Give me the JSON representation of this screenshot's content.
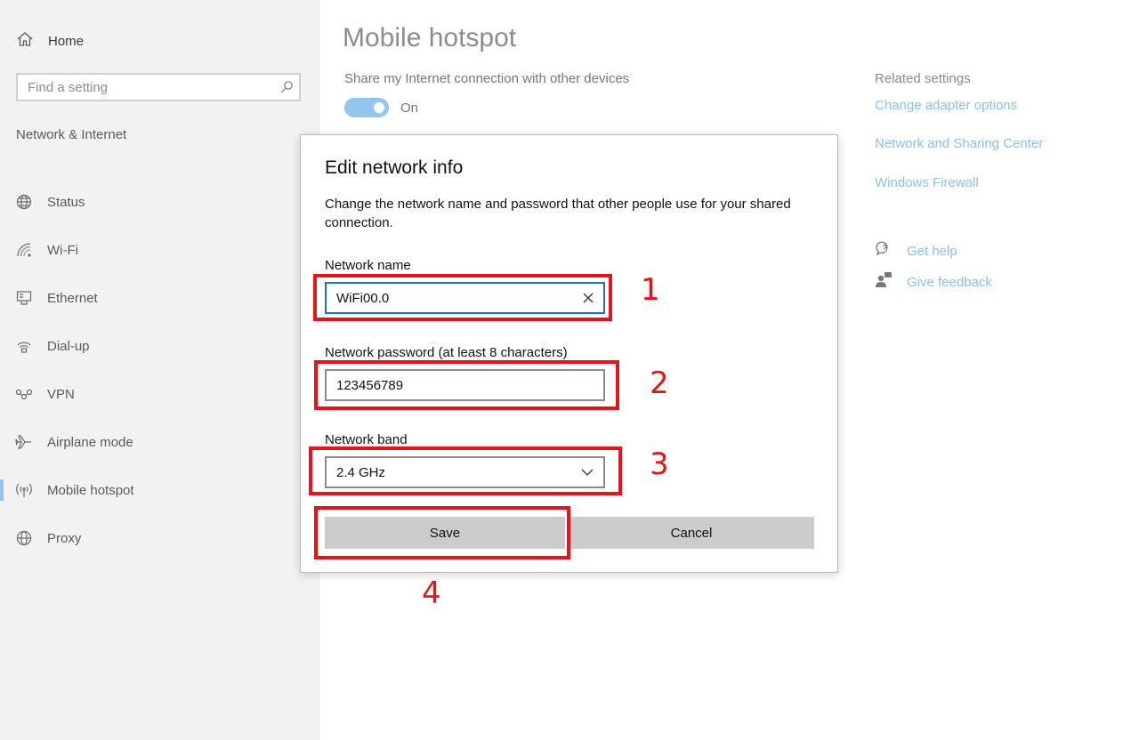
{
  "sidebar": {
    "home_label": "Home",
    "search_placeholder": "Find a setting",
    "section_title": "Network & Internet",
    "items": [
      {
        "label": "Status",
        "icon": "globe-status-icon"
      },
      {
        "label": "Wi-Fi",
        "icon": "wifi-icon"
      },
      {
        "label": "Ethernet",
        "icon": "ethernet-icon"
      },
      {
        "label": "Dial-up",
        "icon": "dial-up-icon"
      },
      {
        "label": "VPN",
        "icon": "vpn-icon"
      },
      {
        "label": "Airplane mode",
        "icon": "airplane-icon"
      },
      {
        "label": "Mobile hotspot",
        "icon": "hotspot-icon",
        "active": true
      },
      {
        "label": "Proxy",
        "icon": "globe-icon"
      }
    ]
  },
  "main": {
    "title": "Mobile hotspot",
    "share_label": "Share my Internet connection with other devices",
    "toggle_state": "On"
  },
  "related": {
    "title": "Related settings",
    "links": [
      "Change adapter options",
      "Network and Sharing Center",
      "Windows Firewall"
    ],
    "get_help": "Get help",
    "give_feedback": "Give feedback"
  },
  "dialog": {
    "title": "Edit network info",
    "description": "Change the network name and password that other people use for your shared connection.",
    "name_label": "Network name",
    "name_value": "WiFi00.0",
    "password_label": "Network password (at least 8 characters)",
    "password_value": "123456789",
    "band_label": "Network band",
    "band_value": "2.4 GHz",
    "save_label": "Save",
    "cancel_label": "Cancel"
  },
  "annotations": [
    "1",
    "2",
    "3",
    "4"
  ],
  "colors": {
    "accent": "#8fc4ea",
    "link": "#8bc0ea",
    "focus": "#1a73c8",
    "annotation": "#e5141b"
  }
}
